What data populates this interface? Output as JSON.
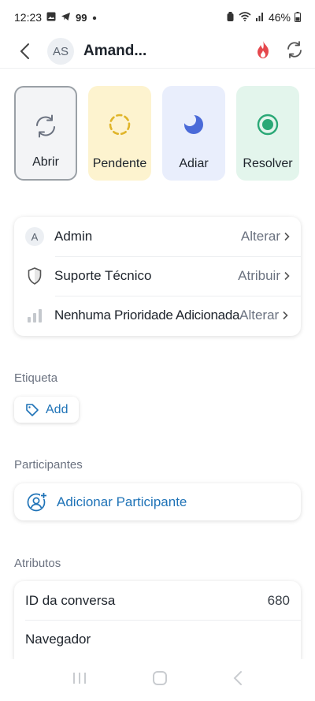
{
  "status_bar": {
    "time": "12:23",
    "notif_count": "99",
    "battery": "46%"
  },
  "header": {
    "avatar_initials": "AS",
    "contact_name": "Amand..."
  },
  "actions": [
    {
      "label": "Abrir",
      "icon": "refresh-icon",
      "color": "#6b7280"
    },
    {
      "label": "Pendente",
      "icon": "dashed-circle-icon",
      "color": "#e0b52a"
    },
    {
      "label": "Adiar",
      "icon": "moon-icon",
      "color": "#4a6ad8"
    },
    {
      "label": "Resolver",
      "icon": "target-icon",
      "color": "#2aa876"
    }
  ],
  "meta": {
    "assignee": {
      "label": "Admin",
      "action": "Alterar",
      "avatar": "A"
    },
    "team": {
      "label": "Suporte Técnico",
      "action": "Atribuir"
    },
    "priority": {
      "label": "Nenhuma Prioridade Adicionada",
      "action": "Alterar"
    }
  },
  "labels_section": {
    "title": "Etiqueta",
    "add_label": "Add"
  },
  "participants_section": {
    "title": "Participantes",
    "add_label": "Adicionar Participante"
  },
  "attributes_section": {
    "title": "Atributos",
    "rows": [
      {
        "label": "ID da conversa",
        "value": "680"
      },
      {
        "label": "Navegador",
        "value": ""
      }
    ]
  },
  "colors": {
    "accent": "#1f73b7",
    "fire": "#e5484d"
  }
}
